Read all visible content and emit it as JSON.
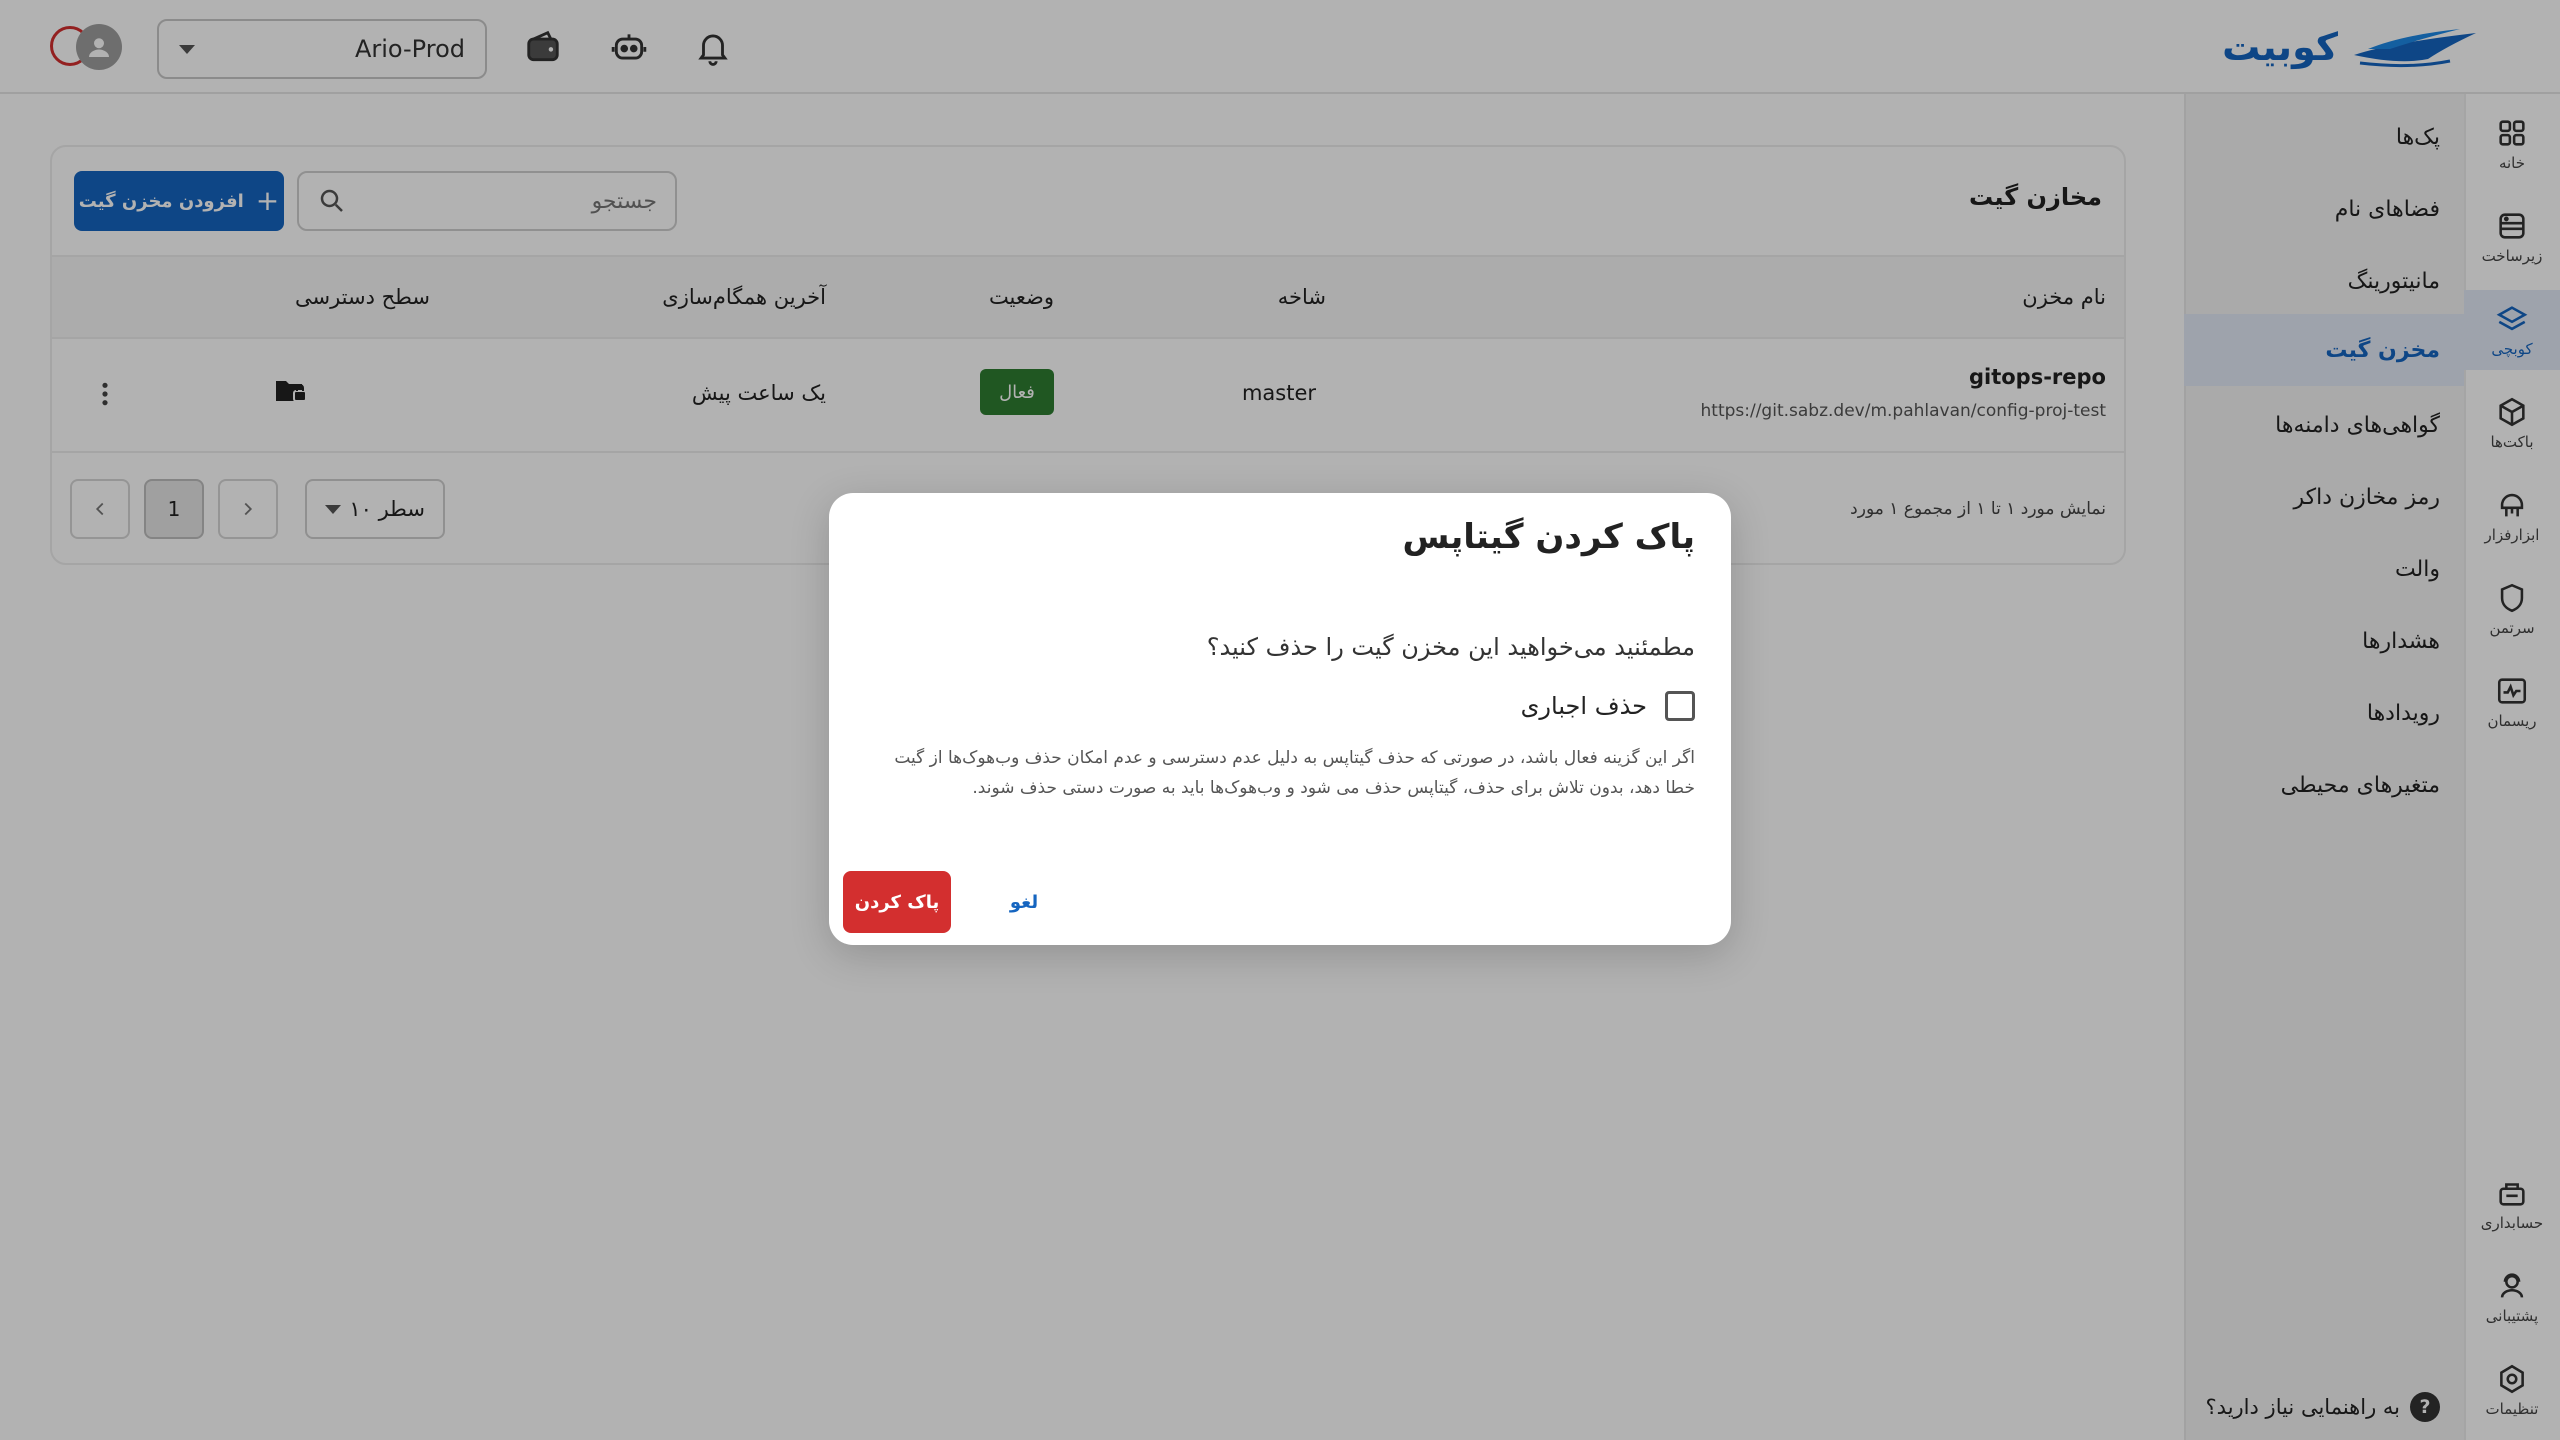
{
  "header": {
    "brand": "کوبیت",
    "environment": "Ario-Prod",
    "icons": [
      "bell-icon",
      "robot-icon",
      "wallet-icon"
    ]
  },
  "rail": {
    "items": [
      {
        "label": "خانه",
        "icon": "grid-icon"
      },
      {
        "label": "زیرساخت",
        "icon": "server-icon"
      },
      {
        "label": "کوبچی",
        "icon": "layers-icon",
        "active": true
      },
      {
        "label": "باکت‌ها",
        "icon": "cube-icon"
      },
      {
        "label": "ابزارفزار",
        "icon": "tools-icon"
      },
      {
        "label": "سرتمن",
        "icon": "shield-icon"
      },
      {
        "label": "ریسمان",
        "icon": "pulse-icon"
      },
      {
        "label": "حسابداری",
        "icon": "accounting-icon"
      },
      {
        "label": "پشتیبانی",
        "icon": "support-icon"
      },
      {
        "label": "تنظیمات",
        "icon": "settings-icon"
      }
    ]
  },
  "subnav": {
    "items": [
      {
        "label": "پک‌ها"
      },
      {
        "label": "فضاهای نام"
      },
      {
        "label": "مانیتورینگ"
      },
      {
        "label": "مخزن گیت",
        "active": true
      },
      {
        "label": "گواهی‌های دامنه‌ها"
      },
      {
        "label": "رمز مخازن داکر"
      },
      {
        "label": "والت"
      },
      {
        "label": "هشدارها"
      },
      {
        "label": "رویدادها"
      },
      {
        "label": "متغیرهای محیطی"
      }
    ],
    "help": "به راهنمایی نیاز دارید؟"
  },
  "card": {
    "title": "مخازن گیت",
    "add_button": "افزودن مخزن گیت",
    "search_placeholder": "جستجو",
    "columns": {
      "name": "نام مخزن",
      "branch": "شاخه",
      "status": "وضعیت",
      "last_sync": "آخرین همگام‌سازی",
      "access": "سطح دسترسی"
    },
    "rows": [
      {
        "name": "gitops-repo",
        "url": "https://git.sabz.dev/m.pahlavan/config-proj-test",
        "branch": "master",
        "status": "فعال",
        "last_sync": "یک ساعت پیش"
      }
    ],
    "pagination": {
      "range_text": "نمایش مورد ۱ تا ۱ از مجموع ۱ مورد",
      "rows_per_page": "۱۰ سطر",
      "current_page": "1"
    }
  },
  "modal": {
    "title": "پاک کردن گیتاپس",
    "question": "مطمئنید می‌خواهید این مخزن گیت را حذف کنید؟",
    "force_label": "حذف اجباری",
    "force_checked": false,
    "note": "اگر این گزینه فعال باشد، در صورتی که حذف گیتاپس به دلیل عدم دسترسی و عدم امکان حذف وب‌هوک‌ها از گیت خطا دهد، بدون تلاش برای حذف، گیتاپس حذف می شود و وب‌هوک‌ها باید به صورت دستی حذف شوند.",
    "confirm_button": "پاک کردن",
    "cancel_button": "لغو"
  },
  "colors": {
    "primary": "#1565c0",
    "danger": "#d32f2f",
    "success": "#2e7d32"
  }
}
